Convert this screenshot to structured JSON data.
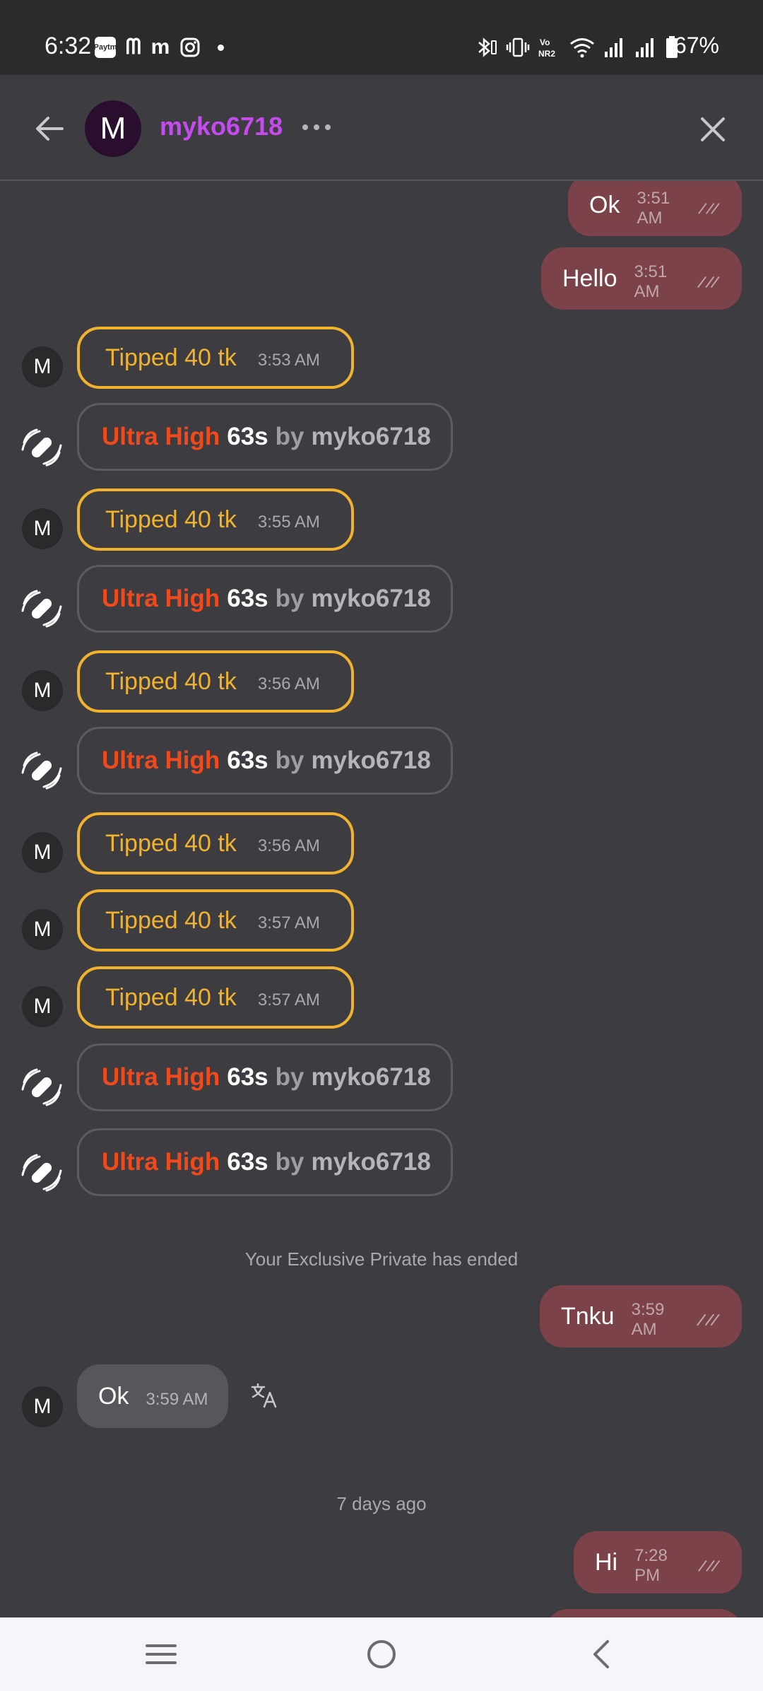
{
  "status_bar": {
    "time": "6:32",
    "app_icons": [
      "paytm-icon",
      "m-app-icon",
      "m-app-icon-2",
      "instagram-icon"
    ],
    "paytm_text": "Paytm",
    "m1": "ᗰ",
    "m2": "m",
    "battery": "67%"
  },
  "header": {
    "avatar_letter": "M",
    "username": "myko6718"
  },
  "messages": [
    {
      "type": "out",
      "text": "Ok",
      "time": "3:51 AM"
    },
    {
      "type": "out",
      "text": "Hello",
      "time": "3:51 AM"
    },
    {
      "type": "tip",
      "avatar": "M",
      "text": "Tipped 40 tk",
      "time": "3:53 AM"
    },
    {
      "type": "toy",
      "level": "Ultra High",
      "duration": "63s",
      "by": "by",
      "user": "myko6718"
    },
    {
      "type": "tip",
      "avatar": "M",
      "text": "Tipped 40 tk",
      "time": "3:55 AM"
    },
    {
      "type": "toy",
      "level": "Ultra High",
      "duration": "63s",
      "by": "by",
      "user": "myko6718"
    },
    {
      "type": "tip",
      "avatar": "M",
      "text": "Tipped 40 tk",
      "time": "3:56 AM"
    },
    {
      "type": "toy",
      "level": "Ultra High",
      "duration": "63s",
      "by": "by",
      "user": "myko6718"
    },
    {
      "type": "tip",
      "avatar": "M",
      "text": "Tipped 40 tk",
      "time": "3:56 AM"
    },
    {
      "type": "tip",
      "avatar": "M",
      "text": "Tipped 40 tk",
      "time": "3:57 AM"
    },
    {
      "type": "tip",
      "avatar": "M",
      "text": "Tipped 40 tk",
      "time": "3:57 AM"
    },
    {
      "type": "toy",
      "level": "Ultra High",
      "duration": "63s",
      "by": "by",
      "user": "myko6718"
    },
    {
      "type": "toy",
      "level": "Ultra High",
      "duration": "63s",
      "by": "by",
      "user": "myko6718"
    },
    {
      "type": "system",
      "text": "Your Exclusive Private has ended"
    },
    {
      "type": "out",
      "text": "Tnku",
      "time": "3:59 AM"
    },
    {
      "type": "in",
      "avatar": "M",
      "text": "Ok",
      "time": "3:59 AM"
    },
    {
      "type": "system",
      "text": "7 days ago"
    },
    {
      "type": "out",
      "text": "Hi",
      "time": "7:28 PM"
    }
  ],
  "colors": {
    "outgoing_bubble": "#7c4249",
    "tip_border": "#f1b22e",
    "toy_level": "#f04a1c",
    "username": "#c64bef",
    "background": "#3d3d41"
  }
}
